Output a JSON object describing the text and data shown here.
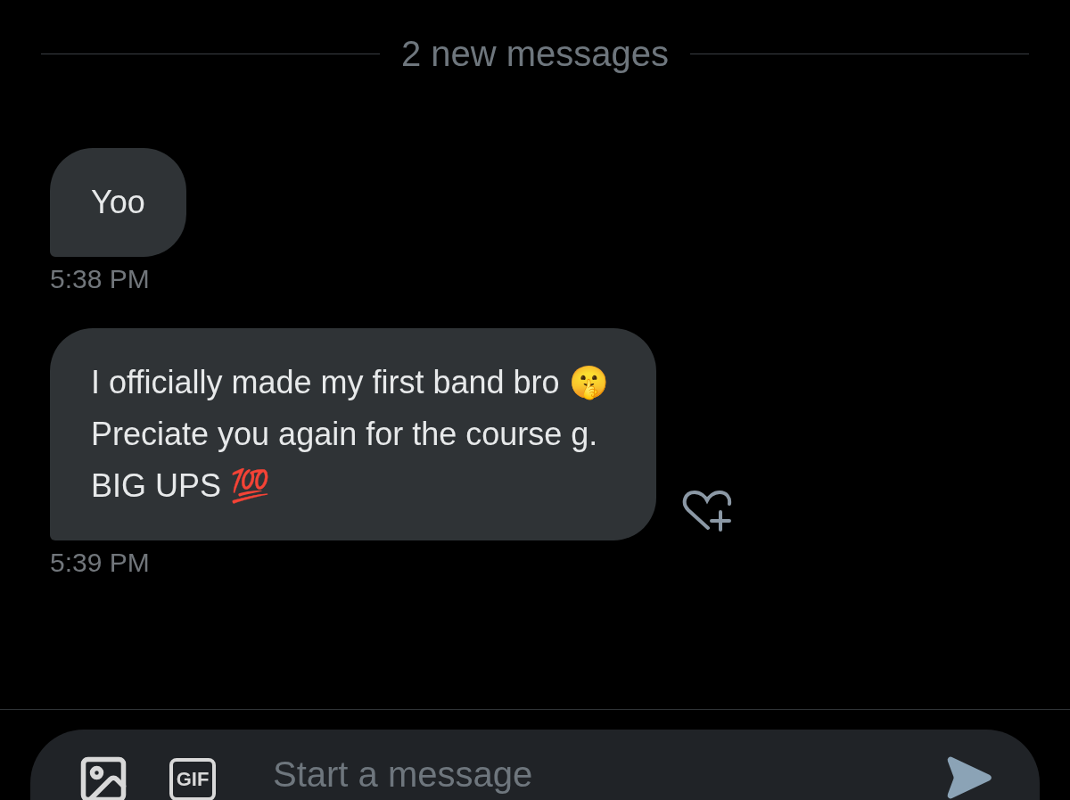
{
  "divider": {
    "label": "2 new messages"
  },
  "messages": [
    {
      "text": "Yoo",
      "time": "5:38 PM",
      "reaction_button": false
    },
    {
      "text": "I officially made my first band bro 🤫 Preciate you again for the course g. BIG UPS 💯",
      "time": "5:39 PM",
      "reaction_button": true
    }
  ],
  "composer": {
    "gif_button": "GIF",
    "placeholder": "Start a message"
  }
}
